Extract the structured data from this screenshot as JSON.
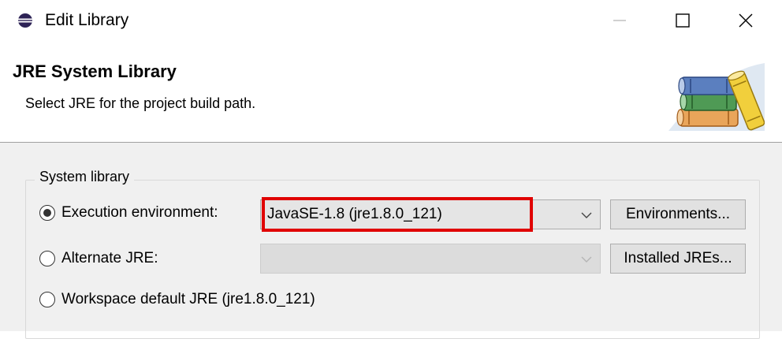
{
  "window": {
    "title": "Edit Library",
    "app_icon": "eclipse-icon",
    "minimize_icon": "minimize-icon",
    "maximize_icon": "maximize-icon",
    "close_icon": "close-icon"
  },
  "header": {
    "title": "JRE System Library",
    "description": "Select JRE for the project build path.",
    "graphic_icon": "library-books-icon"
  },
  "group": {
    "legend": "System library",
    "options": [
      {
        "label": "Execution environment:",
        "selected": true
      },
      {
        "label": "Alternate JRE:",
        "selected": false
      },
      {
        "label": "Workspace default JRE (jre1.8.0_121)",
        "selected": false
      }
    ],
    "execution_env_value": "JavaSE-1.8 (jre1.8.0_121)",
    "alternate_jre_value": "",
    "environments_button": "Environments...",
    "installed_jres_button": "Installed JREs..."
  },
  "colors": {
    "highlight": "#e00000",
    "dialog_bg": "#f0f0f0"
  }
}
